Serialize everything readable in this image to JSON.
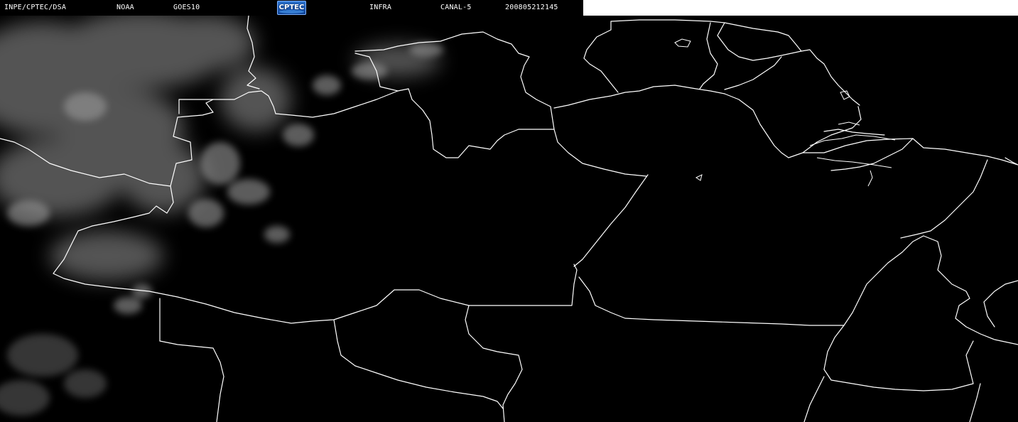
{
  "header": {
    "institution": "INPE/CPTEC/DSA",
    "agency": "NOAA",
    "satellite": "GOES10",
    "logo_text": "CPTEC",
    "band": "INFRA",
    "channel": "CANAL-5",
    "timestamp": "200805212145"
  },
  "colors": {
    "background": "#000000",
    "boundary_lines": "#ffffff",
    "header_text": "#ffffff",
    "logo": "#1f5fbf"
  },
  "icons": {
    "logo": "cptec-logo"
  }
}
